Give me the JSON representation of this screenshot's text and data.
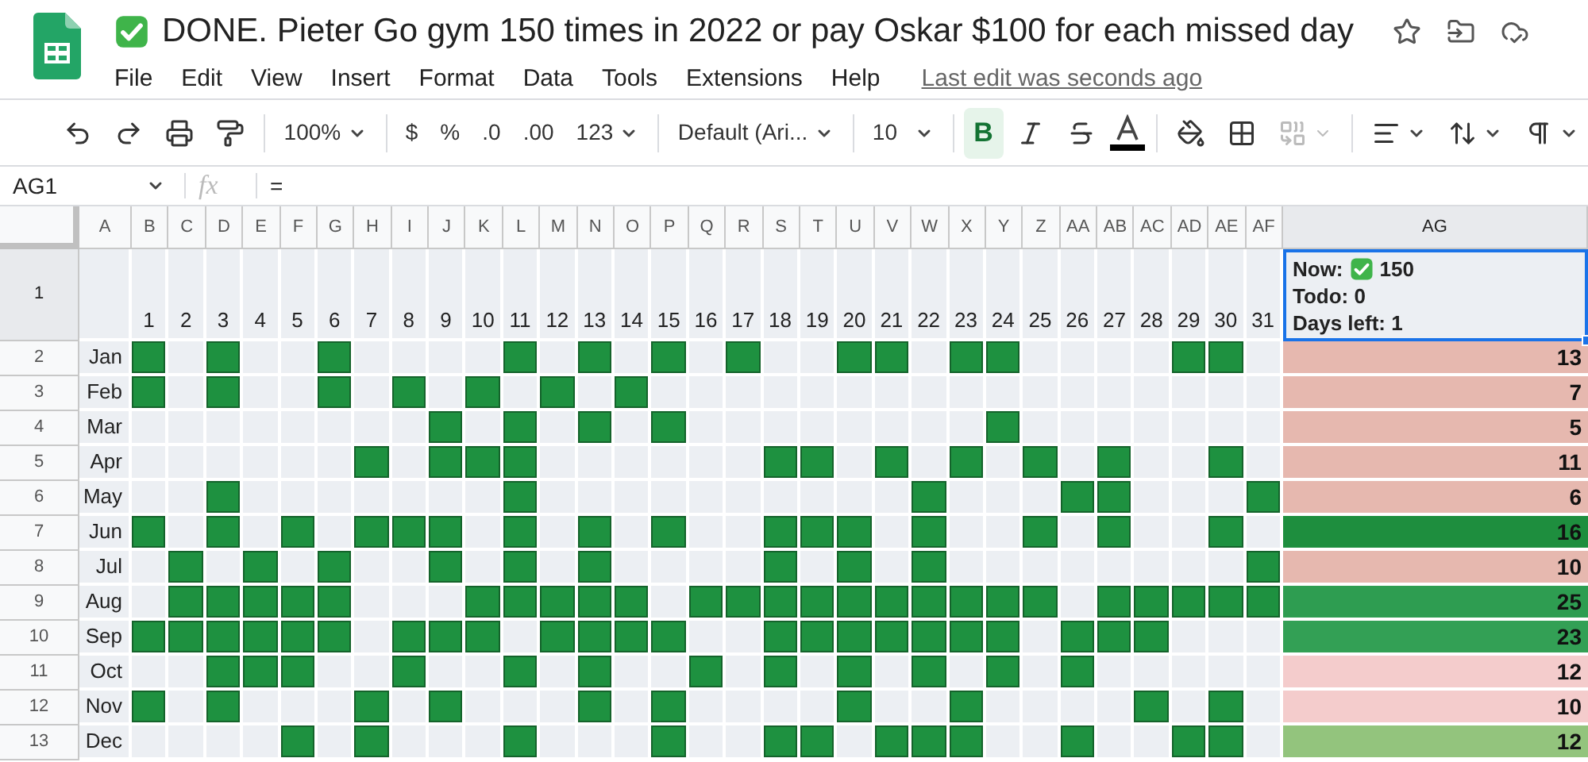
{
  "document": {
    "title": "DONE. Pieter Go gym 150 times in 2022 or pay Oskar $100 for each missed day",
    "menu": [
      "File",
      "Edit",
      "View",
      "Insert",
      "Format",
      "Data",
      "Tools",
      "Extensions",
      "Help"
    ],
    "last_edit": "Last edit was seconds ago"
  },
  "toolbar": {
    "zoom": "100%",
    "currency": "$",
    "percent": "%",
    "decrease_decimals": ".0",
    "increase_decimals": ".00",
    "number_format": "123",
    "font": "Default (Ari...",
    "font_size": "10",
    "bold": "B",
    "bold_on": true
  },
  "formula_bar": {
    "cell": "AG1",
    "fx": "fx",
    "formula": "="
  },
  "columns": [
    {
      "label": "A",
      "selected": false
    },
    {
      "label": "B",
      "selected": false
    },
    {
      "label": "C",
      "selected": false
    },
    {
      "label": "D",
      "selected": false
    },
    {
      "label": "E",
      "selected": false
    },
    {
      "label": "F",
      "selected": false
    },
    {
      "label": "G",
      "selected": false
    },
    {
      "label": "H",
      "selected": false
    },
    {
      "label": "I",
      "selected": false
    },
    {
      "label": "J",
      "selected": false
    },
    {
      "label": "K",
      "selected": false
    },
    {
      "label": "L",
      "selected": false
    },
    {
      "label": "M",
      "selected": false
    },
    {
      "label": "N",
      "selected": false
    },
    {
      "label": "O",
      "selected": false
    },
    {
      "label": "P",
      "selected": false
    },
    {
      "label": "Q",
      "selected": false
    },
    {
      "label": "R",
      "selected": false
    },
    {
      "label": "S",
      "selected": false
    },
    {
      "label": "T",
      "selected": false
    },
    {
      "label": "U",
      "selected": false
    },
    {
      "label": "V",
      "selected": false
    },
    {
      "label": "W",
      "selected": false
    },
    {
      "label": "X",
      "selected": false
    },
    {
      "label": "Y",
      "selected": false
    },
    {
      "label": "Z",
      "selected": false
    },
    {
      "label": "AA",
      "selected": false
    },
    {
      "label": "AB",
      "selected": false
    },
    {
      "label": "AC",
      "selected": false
    },
    {
      "label": "AD",
      "selected": false
    },
    {
      "label": "AE",
      "selected": false
    },
    {
      "label": "AF",
      "selected": false
    },
    {
      "label": "AG",
      "selected": true
    }
  ],
  "header_row": {
    "number": "1",
    "days": [
      "1",
      "2",
      "3",
      "4",
      "5",
      "6",
      "7",
      "8",
      "9",
      "10",
      "11",
      "12",
      "13",
      "14",
      "15",
      "16",
      "17",
      "18",
      "19",
      "20",
      "21",
      "22",
      "23",
      "24",
      "25",
      "26",
      "27",
      "28",
      "29",
      "30",
      "31"
    ],
    "summary": {
      "now_label": "Now:",
      "now_value": "150",
      "todo": "Todo: 0",
      "days_left": "Days left: 1",
      "selected": true
    }
  },
  "rows": [
    {
      "number": "2",
      "month": "Jan",
      "total": "13",
      "color": "#e6b8af",
      "done": [
        true,
        false,
        true,
        false,
        false,
        true,
        false,
        false,
        false,
        false,
        true,
        false,
        true,
        false,
        true,
        false,
        true,
        false,
        false,
        true,
        true,
        false,
        true,
        true,
        false,
        false,
        false,
        false,
        true,
        true,
        false
      ]
    },
    {
      "number": "3",
      "month": "Feb",
      "total": "7",
      "color": "#e6b8af",
      "done": [
        true,
        false,
        true,
        false,
        false,
        true,
        false,
        true,
        false,
        true,
        false,
        true,
        false,
        true,
        false,
        false,
        false,
        false,
        false,
        false,
        false,
        false,
        false,
        false,
        false,
        false,
        false,
        false,
        false,
        false,
        false
      ]
    },
    {
      "number": "4",
      "month": "Mar",
      "total": "5",
      "color": "#e6b8af",
      "done": [
        false,
        false,
        false,
        false,
        false,
        false,
        false,
        false,
        true,
        false,
        true,
        false,
        true,
        false,
        true,
        false,
        false,
        false,
        false,
        false,
        false,
        false,
        false,
        true,
        false,
        false,
        false,
        false,
        false,
        false,
        false
      ]
    },
    {
      "number": "5",
      "month": "Apr",
      "total": "11",
      "color": "#e6b8af",
      "done": [
        false,
        false,
        false,
        false,
        false,
        false,
        true,
        false,
        true,
        true,
        true,
        false,
        false,
        false,
        false,
        false,
        false,
        true,
        true,
        false,
        true,
        false,
        true,
        false,
        true,
        false,
        true,
        false,
        false,
        true,
        false
      ]
    },
    {
      "number": "6",
      "month": "May",
      "total": "6",
      "color": "#e6b8af",
      "done": [
        false,
        false,
        true,
        false,
        false,
        false,
        false,
        false,
        false,
        false,
        true,
        false,
        false,
        false,
        false,
        false,
        false,
        false,
        false,
        false,
        false,
        true,
        false,
        false,
        false,
        true,
        true,
        false,
        false,
        false,
        true
      ]
    },
    {
      "number": "7",
      "month": "Jun",
      "total": "16",
      "color": "#1e8e3e",
      "done": [
        true,
        false,
        true,
        false,
        true,
        false,
        true,
        true,
        true,
        false,
        true,
        false,
        true,
        false,
        true,
        false,
        false,
        true,
        true,
        true,
        false,
        true,
        false,
        false,
        true,
        false,
        true,
        false,
        false,
        true,
        false
      ]
    },
    {
      "number": "8",
      "month": "Jul",
      "total": "10",
      "color": "#e6b8af",
      "done": [
        false,
        true,
        false,
        true,
        false,
        true,
        false,
        false,
        true,
        false,
        true,
        false,
        true,
        false,
        false,
        false,
        false,
        true,
        false,
        true,
        false,
        true,
        false,
        false,
        false,
        false,
        false,
        false,
        false,
        false,
        true
      ]
    },
    {
      "number": "9",
      "month": "Aug",
      "total": "25",
      "color": "#2e9d51",
      "done": [
        false,
        true,
        true,
        true,
        true,
        true,
        false,
        false,
        false,
        true,
        true,
        true,
        true,
        true,
        false,
        true,
        true,
        true,
        true,
        true,
        true,
        true,
        true,
        true,
        true,
        false,
        true,
        true,
        true,
        true,
        true
      ]
    },
    {
      "number": "10",
      "month": "Sep",
      "total": "23",
      "color": "#33a055",
      "done": [
        true,
        true,
        true,
        true,
        true,
        true,
        false,
        true,
        true,
        true,
        false,
        true,
        true,
        true,
        true,
        false,
        false,
        true,
        true,
        true,
        true,
        true,
        true,
        true,
        false,
        true,
        true,
        true,
        false,
        false,
        false
      ]
    },
    {
      "number": "11",
      "month": "Oct",
      "total": "12",
      "color": "#f4cccc",
      "done": [
        false,
        false,
        true,
        true,
        true,
        false,
        false,
        true,
        false,
        false,
        true,
        false,
        true,
        false,
        false,
        true,
        false,
        true,
        false,
        true,
        false,
        true,
        false,
        true,
        false,
        true,
        false,
        false,
        false,
        false,
        false
      ]
    },
    {
      "number": "12",
      "month": "Nov",
      "total": "10",
      "color": "#f4cccc",
      "done": [
        true,
        false,
        true,
        false,
        false,
        false,
        true,
        false,
        true,
        false,
        false,
        false,
        true,
        false,
        true,
        false,
        false,
        false,
        false,
        true,
        false,
        false,
        true,
        false,
        false,
        false,
        false,
        true,
        false,
        true,
        false
      ]
    },
    {
      "number": "13",
      "month": "Dec",
      "total": "12",
      "color": "#93c47d",
      "done": [
        false,
        false,
        false,
        false,
        true,
        false,
        true,
        false,
        false,
        false,
        true,
        false,
        false,
        false,
        true,
        false,
        false,
        true,
        true,
        false,
        true,
        true,
        true,
        false,
        false,
        true,
        false,
        false,
        true,
        true,
        false
      ]
    }
  ]
}
